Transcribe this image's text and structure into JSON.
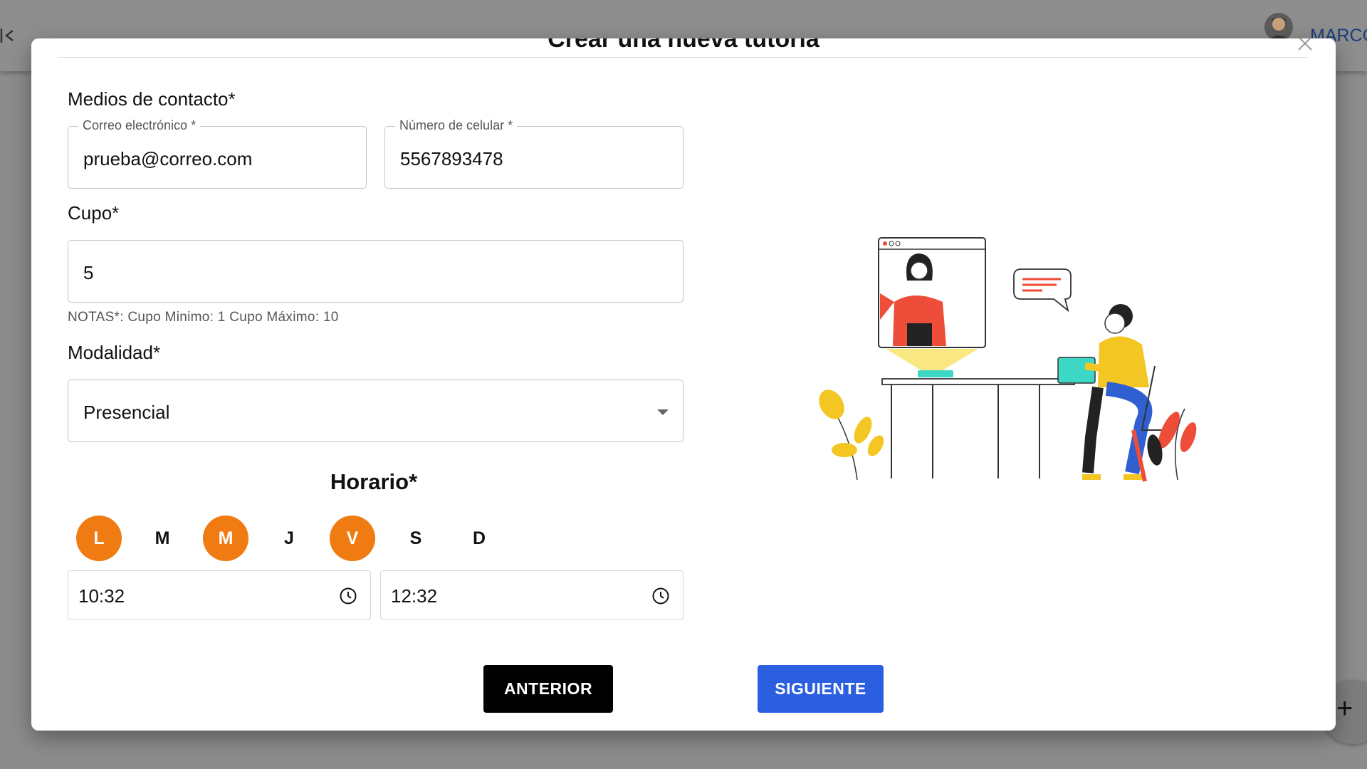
{
  "topbar": {
    "back_icon": "arrow-left-bar-icon",
    "user_name": "MARCO"
  },
  "modal": {
    "title": "Crear una nueva tutoría",
    "close_icon": "close-icon"
  },
  "contact": {
    "section_label": "Medios de contacto*",
    "email": {
      "label": "Correo electrónico *",
      "value": "prueba@correo.com"
    },
    "phone": {
      "label": "Número de celular *",
      "value": "5567893478"
    }
  },
  "cupo": {
    "section_label": "Cupo*",
    "value": "5",
    "helper": "NOTAS*: Cupo Minimo: 1 Cupo Máximo: 10"
  },
  "modalidad": {
    "section_label": "Modalidad*",
    "selected": "Presencial"
  },
  "horario": {
    "title": "Horario*",
    "days": [
      {
        "label": "L",
        "selected": true
      },
      {
        "label": "M",
        "selected": false
      },
      {
        "label": "M",
        "selected": true
      },
      {
        "label": "J",
        "selected": false
      },
      {
        "label": "V",
        "selected": true
      },
      {
        "label": "S",
        "selected": false
      },
      {
        "label": "D",
        "selected": false
      }
    ],
    "start_time": "10:32",
    "end_time": "12:32"
  },
  "buttons": {
    "previous": "ANTERIOR",
    "next": "SIGUIENTE"
  },
  "fab_label": "+",
  "colors": {
    "accent_orange": "#f07b12",
    "primary_blue": "#2b5fe0",
    "overlay": "#8c8c8c"
  }
}
